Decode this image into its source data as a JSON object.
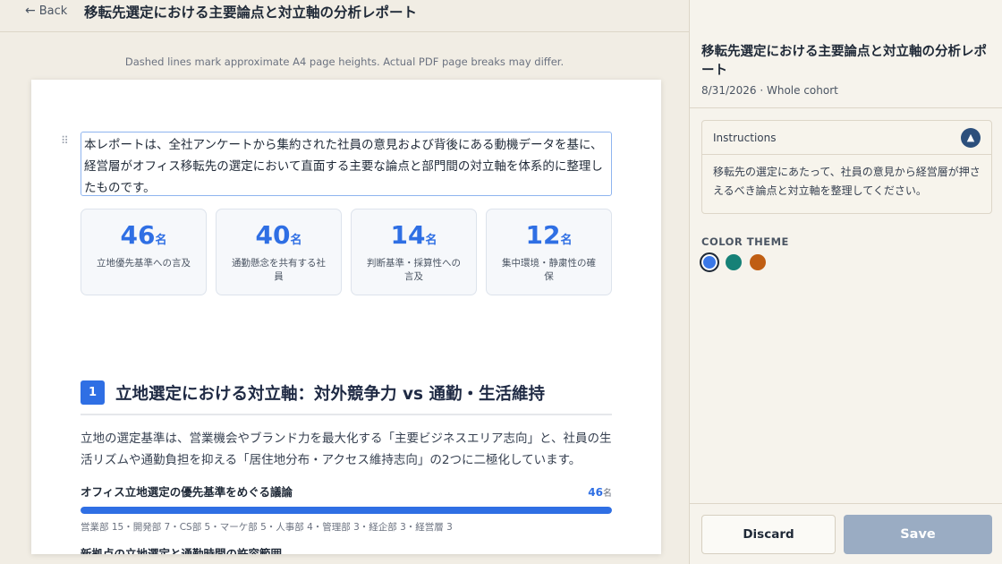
{
  "header": {
    "back_label": "Back",
    "title": "移転先選定における主要論点と対立軸の分析レポート"
  },
  "preview_note": "Dashed lines mark approximate A4 page heights. Actual PDF page breaks may differ.",
  "document": {
    "intro": "本レポートは、全社アンケートから集約された社員の意見および背後にある動機データを基に、経営層がオフィス移転先の選定において直面する主要な論点と部門間の対立軸を体系的に整理したものです。",
    "stats": [
      {
        "value": "46",
        "unit": "名",
        "label": "立地優先基準への言及"
      },
      {
        "value": "40",
        "unit": "名",
        "label": "通勤懸念を共有する社員"
      },
      {
        "value": "14",
        "unit": "名",
        "label": "判断基準・採算性への言及"
      },
      {
        "value": "12",
        "unit": "名",
        "label": "集中環境・静粛性の確保"
      }
    ],
    "section": {
      "number": "1",
      "title": "立地選定における対立軸：対外競争力 vs 通勤・生活維持",
      "body": "立地の選定基準は、営業機会やブランド力を最大化する「主要ビジネスエリア志向」と、社員の生活リズムや通勤負担を抑える「居住地分布・アクセス維持志向」の2つに二極化しています。"
    },
    "topics": [
      {
        "title": "オフィス立地選定の優先基準をめぐる議論",
        "count": "46",
        "unit": "名",
        "fill_fraction": 1.0,
        "breakdown": "営業部 15・開発部 7・CS部 5・マーケ部 5・人事部 4・管理部 3・経企部 3・経営層 3"
      }
    ],
    "next_topic_title": "新拠点の立地選定と通勤時間の許容範囲"
  },
  "panel": {
    "title": "移転先選定における主要論点と対立軸の分析レポート",
    "meta": "8/31/2026 · Whole cohort",
    "instructions_label": "Instructions",
    "instructions_text": "移転先の選定にあたって、社員の意見から経営層が押さえるべき論点と対立軸を整理してください。",
    "color_theme_label": "COLOR THEME",
    "themes": [
      {
        "name": "blue",
        "color": "#3b78e7",
        "selected": true
      },
      {
        "name": "teal",
        "color": "#168177",
        "selected": false
      },
      {
        "name": "orange",
        "color": "#c05e13",
        "selected": false
      }
    ],
    "discard_label": "Discard",
    "save_label": "Save"
  },
  "colors": {
    "accent": "#2f6fe4",
    "save_disabled": "#9aacc3",
    "collapse_button": "#2c4f7c"
  },
  "icons": [
    "arrow-left-icon",
    "drag-handle-icon",
    "chevron-up-icon"
  ]
}
